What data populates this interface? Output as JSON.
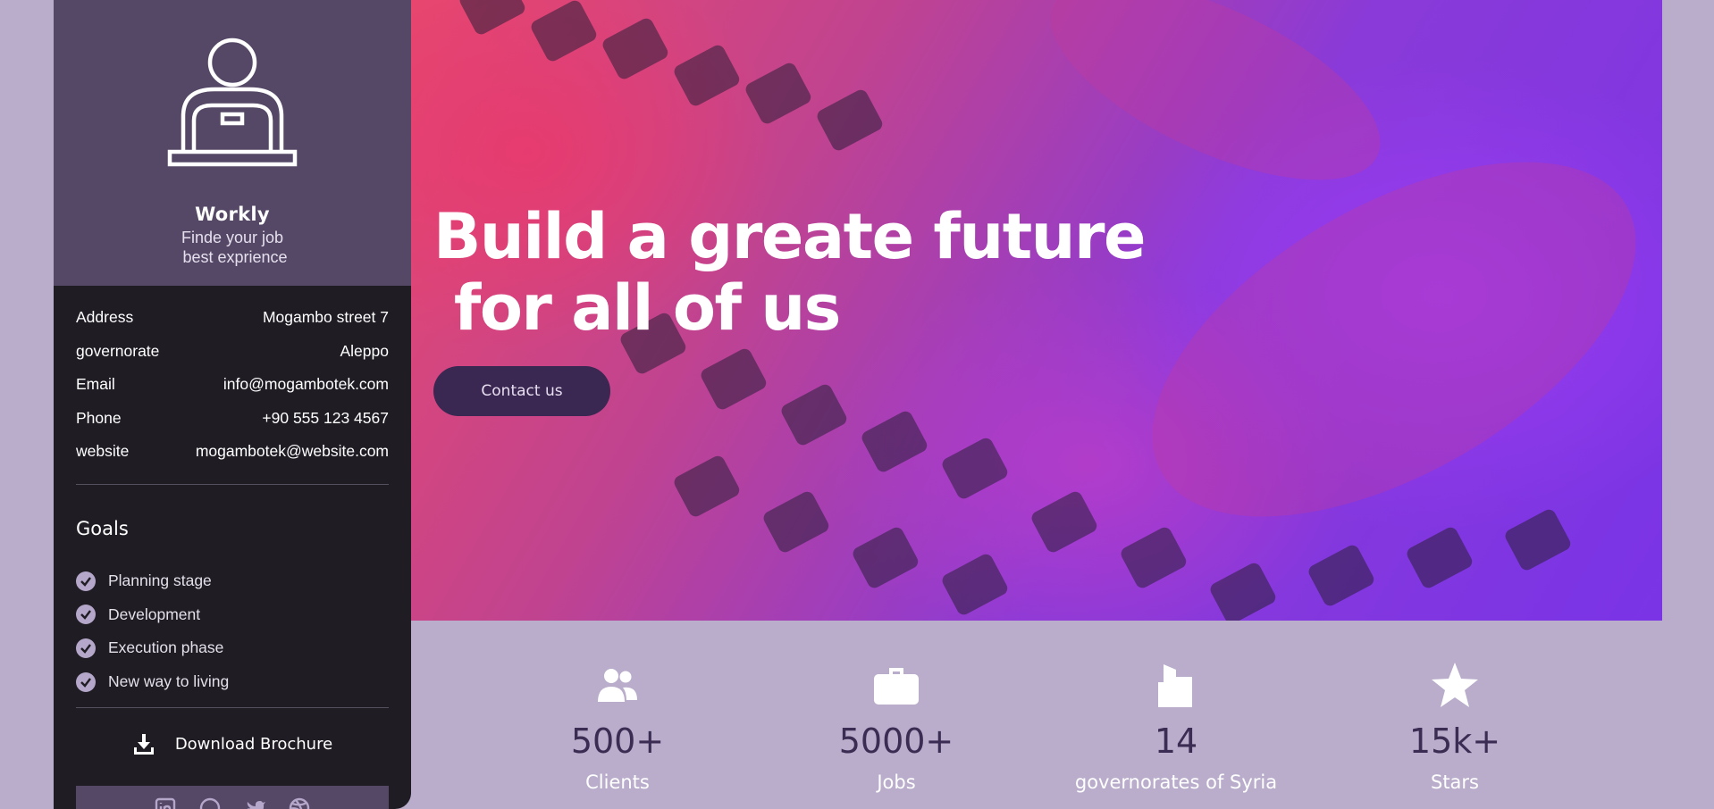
{
  "sidebar": {
    "brand_name": "Workly",
    "tagline_line1": "Finde your job",
    "tagline_line2": "best exprience",
    "info": [
      {
        "label": "Address",
        "value": "Mogambo street 7"
      },
      {
        "label": "governorate",
        "value": "Aleppo"
      },
      {
        "label": "Email",
        "value": "info@mogambotek.com"
      },
      {
        "label": "Phone",
        "value": "+90 555 123 4567"
      },
      {
        "label": "website",
        "value": "mogambotek@website.com"
      }
    ],
    "goals_title": "Goals",
    "goals": [
      "Planning stage",
      "Development",
      "Execution phase",
      "New way to living"
    ],
    "download_label": "Download Brochure",
    "social_icons": [
      "linkedin-icon",
      "github-icon",
      "twitter-icon",
      "dribbble-icon"
    ]
  },
  "hero": {
    "title": "Build a greate future\n for all of us",
    "cta_label": "Contact us"
  },
  "stats": [
    {
      "icon": "users-icon",
      "number": "500+",
      "label": "Clients"
    },
    {
      "icon": "briefcase-icon",
      "number": "5000+",
      "label": "Jobs"
    },
    {
      "icon": "building-icon",
      "number": "14",
      "label": "governorates of Syria"
    },
    {
      "icon": "star-icon",
      "number": "15k+",
      "label": "Stars"
    }
  ],
  "colors": {
    "background": "#b9adcb",
    "sidebar": "#1f1c24",
    "profile": "#544866",
    "accent": "#3a2752",
    "check": "#b4a7c9"
  }
}
